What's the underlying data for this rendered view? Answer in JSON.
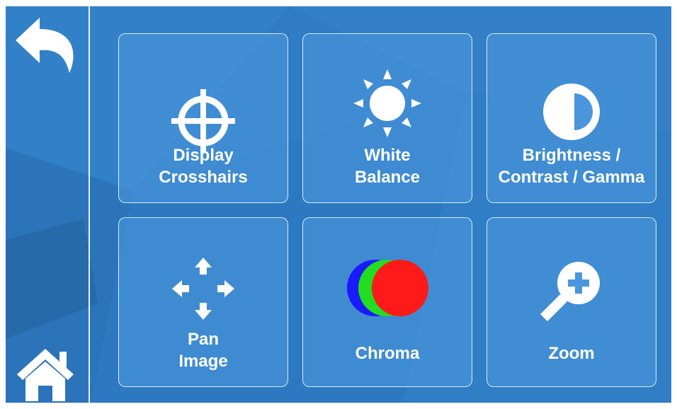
{
  "nav": {
    "back_icon": "back-arrow-icon",
    "home_icon": "home-icon"
  },
  "tiles": [
    {
      "label": "Display\nCrosshairs",
      "icon": "crosshair-icon"
    },
    {
      "label": "White\nBalance",
      "icon": "sun-icon"
    },
    {
      "label": "Brightness /\nContrast / Gamma",
      "icon": "contrast-icon"
    },
    {
      "label": "Pan\nImage",
      "icon": "move-arrows-icon"
    },
    {
      "label": "Chroma",
      "icon": "rgb-circles-icon"
    },
    {
      "label": "Zoom",
      "icon": "zoom-in-icon"
    }
  ],
  "colors": {
    "background": "#2f7cc4",
    "tile_fill": "#4a96dc",
    "tile_border": "#e1eefa",
    "icon": "#ffffff",
    "chroma_red": "#ff1a1a",
    "chroma_green": "#22dd22",
    "chroma_blue": "#1a1aff"
  }
}
